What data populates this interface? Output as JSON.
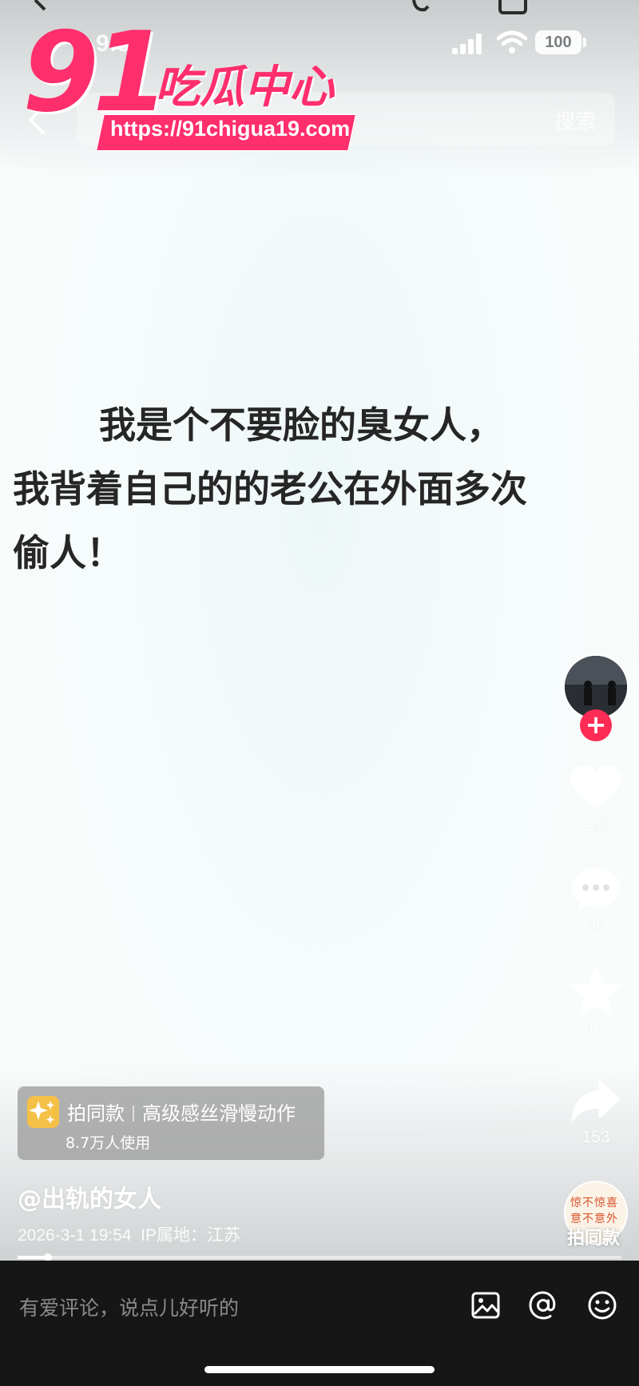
{
  "status_bar": {
    "time": "9:33",
    "battery": "100"
  },
  "header": {
    "search_label": "搜索"
  },
  "watermark": {
    "number": "91",
    "name": "吃瓜中心",
    "url": "https://91chigua19.com"
  },
  "video": {
    "text_line1": "我是个不要脸的臭女人，",
    "text_line2": "我背着自己的的老公在外面多次",
    "text_line3": "偷人！"
  },
  "actions": {
    "likes": "190",
    "comments": "95",
    "favorites": "12",
    "shares": "153",
    "remix_label": "拍同款",
    "remix_disc_text": "惊不惊喜意不意外"
  },
  "template_card": {
    "label": "拍同款",
    "name": "高级感丝滑慢动作",
    "users": "8.7万人使用"
  },
  "post": {
    "author": "@出轨的女人",
    "date": "2026-3-1 19:54",
    "ip_location": "IP属地：江苏",
    "progress": 0.05
  },
  "comment_bar": {
    "placeholder": "有爱评论，说点儿好听的"
  },
  "icons": {
    "back": "back-icon",
    "like": "heart-icon",
    "comment": "comment-icon",
    "favorite": "star-icon",
    "share": "share-icon",
    "image": "image-icon",
    "mention": "at-icon",
    "emoji": "emoji-icon"
  },
  "colors": {
    "accent": "#fe2c55",
    "watermark": "#ff2e6c",
    "bar_background": "#161616"
  }
}
